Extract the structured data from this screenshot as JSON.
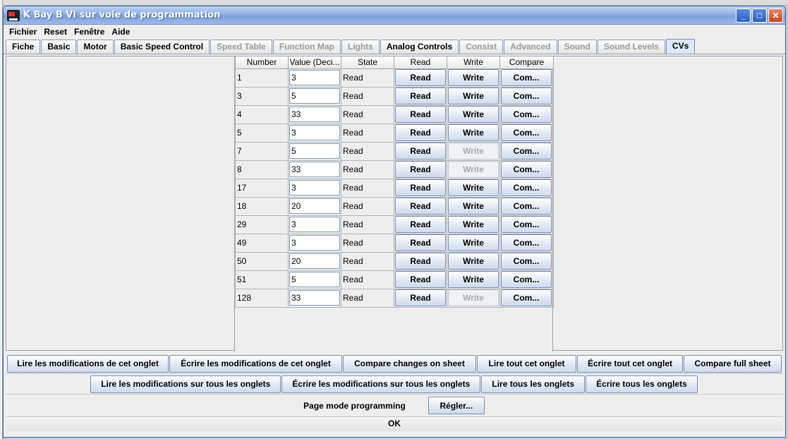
{
  "window": {
    "title": "K Bay B VI sur voie de programmation",
    "controls": [
      "_",
      "□",
      "✕"
    ]
  },
  "menu": [
    "Fichier",
    "Reset",
    "Fenêtre",
    "Aide"
  ],
  "tabs": [
    {
      "label": "Fiche",
      "enabled": true
    },
    {
      "label": "Basic",
      "enabled": true
    },
    {
      "label": "Motor",
      "enabled": true
    },
    {
      "label": "Basic Speed Control",
      "enabled": true
    },
    {
      "label": "Speed Table",
      "enabled": false
    },
    {
      "label": "Function Map",
      "enabled": false
    },
    {
      "label": "Lights",
      "enabled": false
    },
    {
      "label": "Analog Controls",
      "enabled": true
    },
    {
      "label": "Consist",
      "enabled": false
    },
    {
      "label": "Advanced",
      "enabled": false
    },
    {
      "label": "Sound",
      "enabled": false
    },
    {
      "label": "Sound Levels",
      "enabled": false
    },
    {
      "label": "CVs",
      "enabled": true,
      "active": true
    }
  ],
  "cv_table": {
    "headers": [
      "Number",
      "Value (Deci...",
      "State",
      "Read",
      "Write",
      "Compare"
    ],
    "read_label": "Read",
    "write_label": "Write",
    "compare_label": "Com...",
    "rows": [
      {
        "number": "1",
        "value": "3",
        "state": "Read",
        "write_enabled": true
      },
      {
        "number": "3",
        "value": "5",
        "state": "Read",
        "write_enabled": true
      },
      {
        "number": "4",
        "value": "33",
        "state": "Read",
        "write_enabled": true
      },
      {
        "number": "5",
        "value": "3",
        "state": "Read",
        "write_enabled": true
      },
      {
        "number": "7",
        "value": "5",
        "state": "Read",
        "write_enabled": false
      },
      {
        "number": "8",
        "value": "33",
        "state": "Read",
        "write_enabled": false
      },
      {
        "number": "17",
        "value": "3",
        "state": "Read",
        "write_enabled": true
      },
      {
        "number": "18",
        "value": "20",
        "state": "Read",
        "write_enabled": true
      },
      {
        "number": "29",
        "value": "3",
        "state": "Read",
        "write_enabled": true
      },
      {
        "number": "49",
        "value": "3",
        "state": "Read",
        "write_enabled": true
      },
      {
        "number": "50",
        "value": "20",
        "state": "Read",
        "write_enabled": true
      },
      {
        "number": "51",
        "value": "5",
        "state": "Read",
        "write_enabled": true
      },
      {
        "number": "128",
        "value": "33",
        "state": "Read",
        "write_enabled": false
      }
    ]
  },
  "sheet_buttons": [
    "Lire les modifications de cet onglet",
    "Écrire les modifications de cet onglet",
    "Compare changes on sheet",
    "Lire tout cet onglet",
    "Écrire tout cet onglet",
    "Compare full sheet"
  ],
  "all_buttons": [
    "Lire les modifications sur tous les onglets",
    "Écrire les modifications sur tous les onglets",
    "Lire tous les onglets",
    "Écrire tous les onglets"
  ],
  "mode": {
    "label": "Page mode programming",
    "set_button": "Régler..."
  },
  "ok_label": "OK"
}
